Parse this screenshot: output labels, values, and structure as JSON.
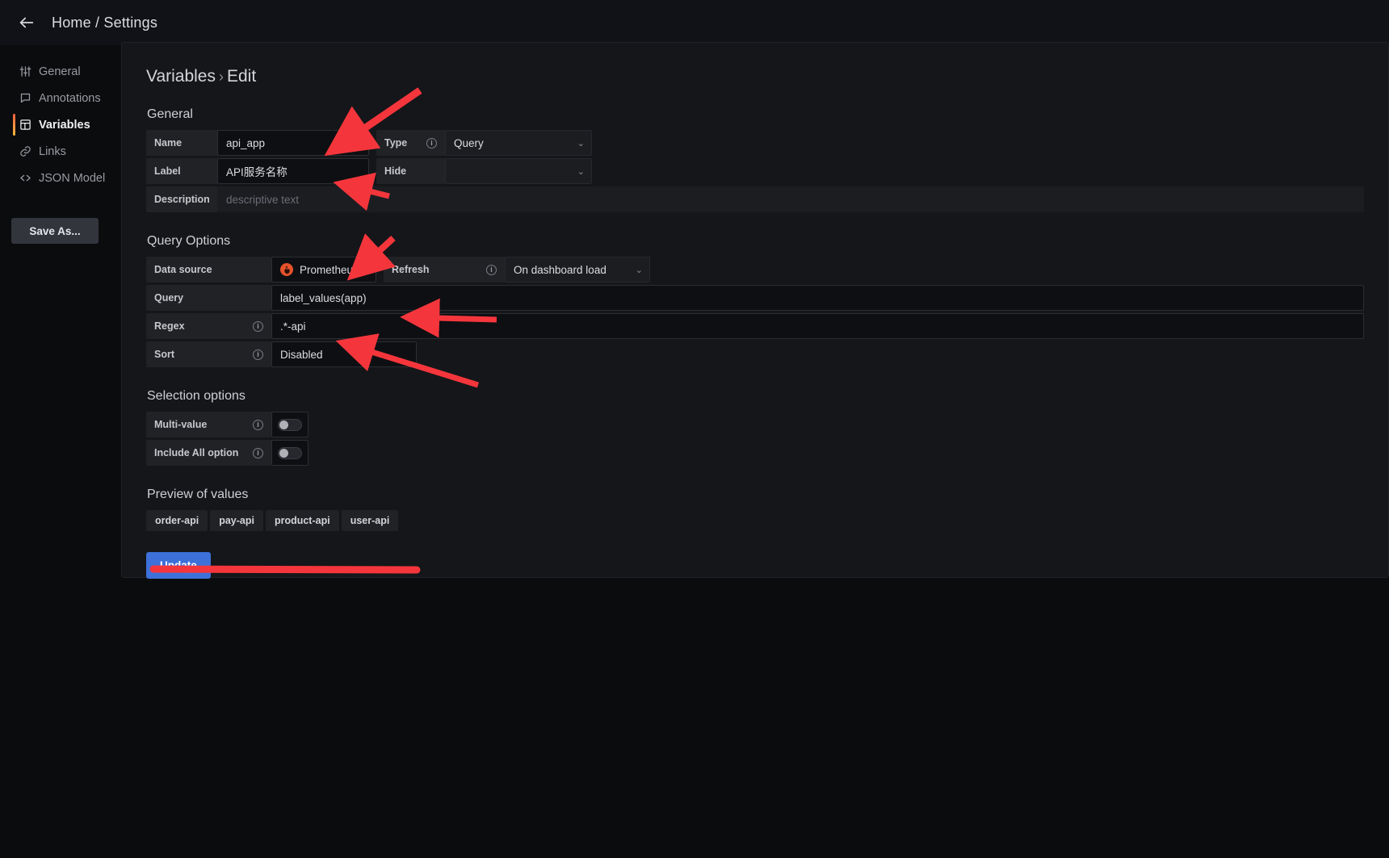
{
  "topbar": {
    "back_icon": "arrow-left-icon",
    "breadcrumb": "Home / Settings"
  },
  "sidebar": {
    "items": [
      {
        "label": "General",
        "icon": "sliders-icon",
        "active": false
      },
      {
        "label": "Annotations",
        "icon": "comment-icon",
        "active": false
      },
      {
        "label": "Variables",
        "icon": "table-icon",
        "active": true
      },
      {
        "label": "Links",
        "icon": "link-icon",
        "active": false
      },
      {
        "label": "JSON Model",
        "icon": "code-icon",
        "active": false
      }
    ],
    "save_as_label": "Save As..."
  },
  "page": {
    "title": "Variables",
    "separator": "›",
    "subtitle": "Edit"
  },
  "general": {
    "heading": "General",
    "name_label": "Name",
    "name_value": "api_app",
    "type_label": "Type",
    "type_value": "Query",
    "label_label": "Label",
    "label_value": "API服务名称",
    "hide_label": "Hide",
    "hide_value": "",
    "description_label": "Description",
    "description_placeholder": "descriptive text"
  },
  "query_options": {
    "heading": "Query Options",
    "datasource_label": "Data source",
    "datasource_value": "Prometheus",
    "datasource_icon": "prometheus-icon",
    "refresh_label": "Refresh",
    "refresh_value": "On dashboard load",
    "query_label": "Query",
    "query_value": "label_values(app)",
    "regex_label": "Regex",
    "regex_value": ".*-api",
    "sort_label": "Sort",
    "sort_value": "Disabled"
  },
  "selection_options": {
    "heading": "Selection options",
    "multi_value_label": "Multi-value",
    "multi_value_on": false,
    "include_all_label": "Include All option",
    "include_all_on": false
  },
  "preview": {
    "heading": "Preview of values",
    "values": [
      "order-api",
      "pay-api",
      "product-api",
      "user-api"
    ]
  },
  "actions": {
    "update_label": "Update",
    "update_color": "#3d71d9"
  },
  "annotations": {
    "color": "#f4363c",
    "arrow_count": 4,
    "underline_count": 1
  }
}
